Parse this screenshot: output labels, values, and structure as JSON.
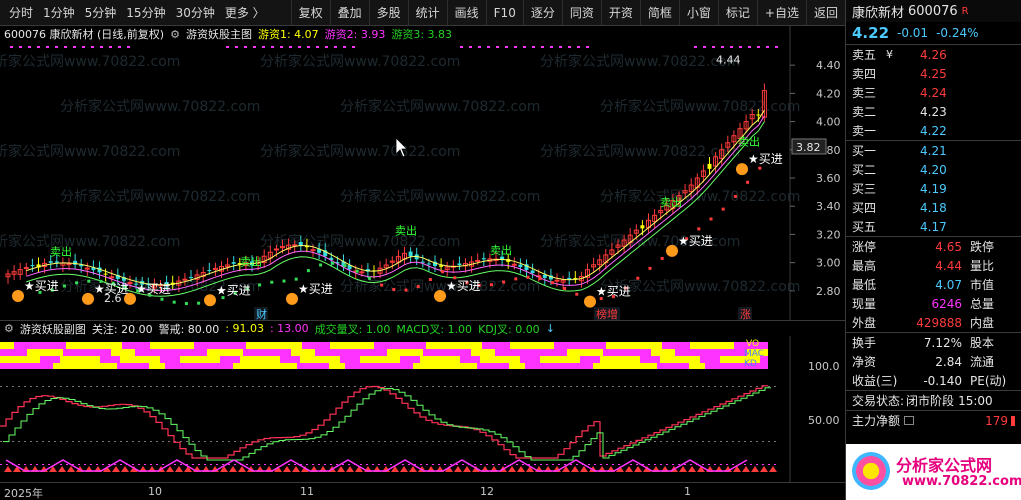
{
  "toolbar": {
    "left": [
      "分时",
      "1分钟",
      "5分钟",
      "15分钟",
      "30分钟",
      "更多 〉"
    ],
    "right": [
      "复权",
      "叠加",
      "多股",
      "统计",
      "画线",
      "F10",
      "逐分",
      "同资",
      "开资",
      "简框",
      "小窗",
      "标记",
      "+自选",
      "返回"
    ]
  },
  "main_chart": {
    "stock_title": "600076 康欣新材 (日线,前复权)",
    "indicator_name": "游资妖股主图",
    "legend": [
      {
        "label": "游资1: 4.07",
        "color": "#ffff00"
      },
      {
        "label": "游资2: 3.93",
        "color": "#ff33ff"
      },
      {
        "label": "游资3: 3.83",
        "color": "#33ff33"
      }
    ],
    "price_axis": [
      "4.40",
      "4.20",
      "4.00",
      "3.80",
      "3.60",
      "3.40",
      "3.20",
      "3.00",
      "2.80"
    ],
    "current_price_tag": "3.82",
    "high_label": "4.44",
    "low_label": "2.6",
    "signals": [
      {
        "text": "★买进",
        "kind": "buy"
      },
      {
        "text": "★买进",
        "kind": "buy"
      },
      {
        "text": "★买进",
        "kind": "buy"
      },
      {
        "text": "★买进",
        "kind": "buy"
      },
      {
        "text": "★买进",
        "kind": "buy"
      },
      {
        "text": "★买进",
        "kind": "buy"
      },
      {
        "text": "★买进",
        "kind": "buy"
      },
      {
        "text": "★买进",
        "kind": "buy"
      },
      {
        "text": "★买进",
        "kind": "buy"
      },
      {
        "text": "卖出",
        "kind": "sell"
      },
      {
        "text": "卖出",
        "kind": "sell"
      },
      {
        "text": "卖出",
        "kind": "sell"
      },
      {
        "text": "卖出",
        "kind": "sell"
      },
      {
        "text": "卖出",
        "kind": "sell"
      },
      {
        "text": "卖出",
        "kind": "sell"
      }
    ],
    "tags": [
      {
        "text": "财",
        "color": "#4cc9ff"
      },
      {
        "text": "榜增",
        "color": "#ff3b3b"
      },
      {
        "text": "涨",
        "color": "#ff3b3b"
      }
    ],
    "watermark": "分析家公式网www.70822.com"
  },
  "sub_chart": {
    "indicator_name": "游资妖股副图",
    "params": [
      {
        "label": "关注: 20.00",
        "color": "#e6e6e6"
      },
      {
        "label": "警戒: 80.00",
        "color": "#e6e6e6"
      },
      {
        "label": ": 91.03",
        "color": "#ffff00"
      },
      {
        "label": ": 13.00",
        "color": "#ff33ff"
      },
      {
        "label": "成交量叉: 1.00",
        "color": "#33ff33"
      },
      {
        "label": "MACD叉: 1.00",
        "color": "#33ff33"
      },
      {
        "label": "KDJ叉: 0.00",
        "color": "#33ff33"
      }
    ],
    "axis": [
      "100.0",
      "50.00"
    ],
    "right_labels": [
      "VO",
      "MAC",
      "KD"
    ]
  },
  "x_axis": [
    "2025年",
    "10",
    "11",
    "12",
    "1"
  ],
  "quote": {
    "name": "康欣新材",
    "code": "600076",
    "badge": "R",
    "price": "4.22",
    "change": "-0.01",
    "change_pct": "-0.24%",
    "asks": [
      {
        "label": "卖五",
        "mark": "¥",
        "price": "4.26",
        "color": "#ff3b3b"
      },
      {
        "label": "卖四",
        "mark": "",
        "price": "4.25",
        "color": "#ff3b3b"
      },
      {
        "label": "卖三",
        "mark": "",
        "price": "4.24",
        "color": "#ff3b3b"
      },
      {
        "label": "卖二",
        "mark": "",
        "price": "4.23",
        "color": "#e6e6e6"
      },
      {
        "label": "卖一",
        "mark": "",
        "price": "4.22",
        "color": "#4cc9ff"
      }
    ],
    "bids": [
      {
        "label": "买一",
        "price": "4.21",
        "color": "#4cc9ff"
      },
      {
        "label": "买二",
        "price": "4.20",
        "color": "#4cc9ff"
      },
      {
        "label": "买三",
        "price": "4.19",
        "color": "#4cc9ff"
      },
      {
        "label": "买四",
        "price": "4.18",
        "color": "#4cc9ff"
      },
      {
        "label": "买五",
        "price": "4.17",
        "color": "#4cc9ff"
      }
    ],
    "stats": [
      {
        "label": "涨停",
        "value": "4.65",
        "vcolor": "#ff3b3b",
        "label2": "跌停"
      },
      {
        "label": "最高",
        "value": "4.44",
        "vcolor": "#ff3b3b",
        "label2": "量比"
      },
      {
        "label": "最低",
        "value": "4.07",
        "vcolor": "#4cc9ff",
        "label2": "市值"
      },
      {
        "label": "现量",
        "value": "6246",
        "vcolor": "#ff33ff",
        "label2": "总量"
      },
      {
        "label": "外盘",
        "value": "429888",
        "vcolor": "#ff3b3b",
        "label2": "内盘"
      }
    ],
    "stats2": [
      {
        "label": "换手",
        "value": "7.12%",
        "vcolor": "#e6e6e6",
        "label2": "股本"
      },
      {
        "label": "净资",
        "value": "2.84",
        "vcolor": "#e6e6e6",
        "label2": "流通"
      },
      {
        "label": "收益(三)",
        "value": "-0.140",
        "vcolor": "#e6e6e6",
        "label2": "PE(动)"
      }
    ],
    "trade_status_label": "交易状态:",
    "trade_status_value": "闭市阶段",
    "trade_status_time": "15:00",
    "main_flow_label": "主力净额",
    "main_flow_value": "179",
    "logo_text": "分析家公式网",
    "logo_url": "www.70822.com"
  }
}
